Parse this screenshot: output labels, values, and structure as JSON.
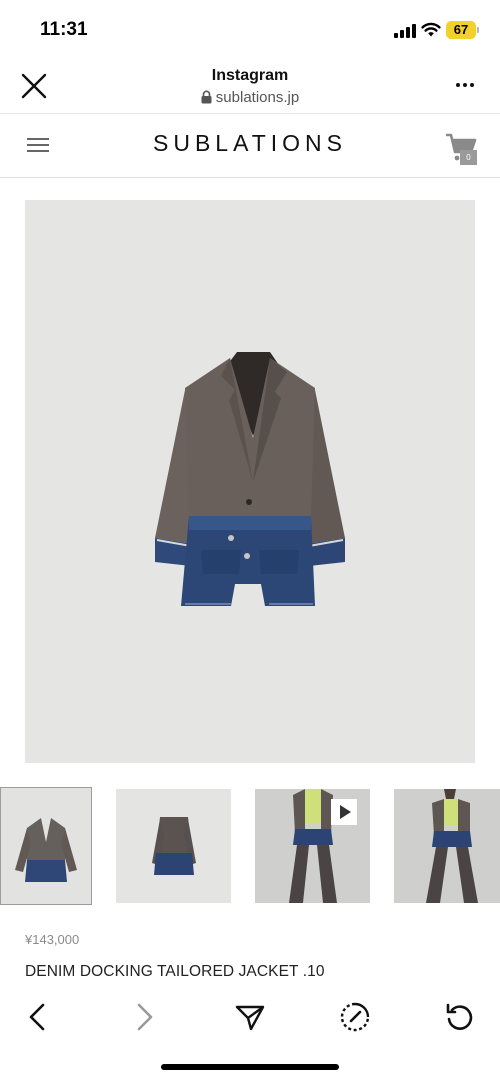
{
  "status_bar": {
    "time": "11:31",
    "battery": "67",
    "battery_color": "#f2d12b"
  },
  "browser": {
    "title": "Instagram",
    "url": "sublations.jp",
    "icons": [
      "close-icon",
      "lock-icon",
      "more-icon"
    ]
  },
  "site": {
    "brand": "SUBLATIONS",
    "cart_count": "0",
    "icons": [
      "hamburger-menu-icon",
      "cart-icon"
    ]
  },
  "gallery": {
    "main_image": "product-image-jacket",
    "thumbnails": [
      "thumbnail-jacket-front",
      "thumbnail-jacket-back",
      "thumbnail-model-video",
      "thumbnail-model"
    ],
    "video_icon": "play-icon"
  },
  "product": {
    "price": "¥143,000",
    "name": "DENIM DOCKING TAILORED JACKET .10"
  },
  "toolbar": {
    "icons": [
      "back-arrow-icon",
      "forward-arrow-icon",
      "share-icon",
      "compass-icon",
      "refresh-icon"
    ]
  }
}
